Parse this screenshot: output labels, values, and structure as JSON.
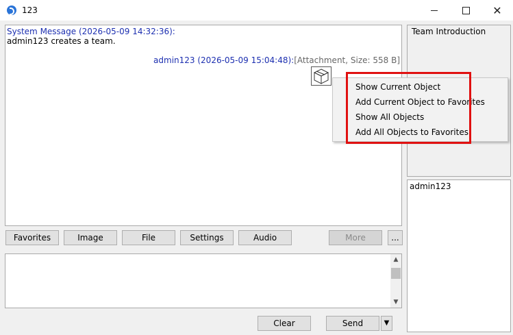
{
  "window": {
    "title": "123",
    "icon": "app-logo-icon",
    "controls": {
      "minimize": "minimize-icon",
      "maximize": "maximize-icon",
      "close": "✕"
    }
  },
  "chat": {
    "system_header": "System Message (2026-05-09 14:32:36):",
    "system_body": "admin123 creates a team.",
    "user_header": "admin123 (2026-05-09 15:04:48):",
    "attachment_label": "[Attachment, Size: 558 B]",
    "attachment_icon": "cube-icon"
  },
  "context_menu": {
    "items": [
      "Show Current Object",
      "Add Current Object to Favorites",
      "Show All Objects",
      "Add All Objects to Favorites"
    ],
    "highlight_color": "#e01010"
  },
  "toolbar": {
    "favorites": "Favorites",
    "image": "Image",
    "file": "File",
    "settings": "Settings",
    "audio": "Audio",
    "more": "More",
    "ellipsis": "..."
  },
  "input": {
    "value": "",
    "scroll_up": "▲",
    "scroll_down": "▼"
  },
  "actions": {
    "clear": "Clear",
    "send": "Send",
    "send_dropdown": "▼"
  },
  "side_panel": {
    "team_intro_title": "Team Introduction",
    "members": [
      "admin123"
    ]
  }
}
